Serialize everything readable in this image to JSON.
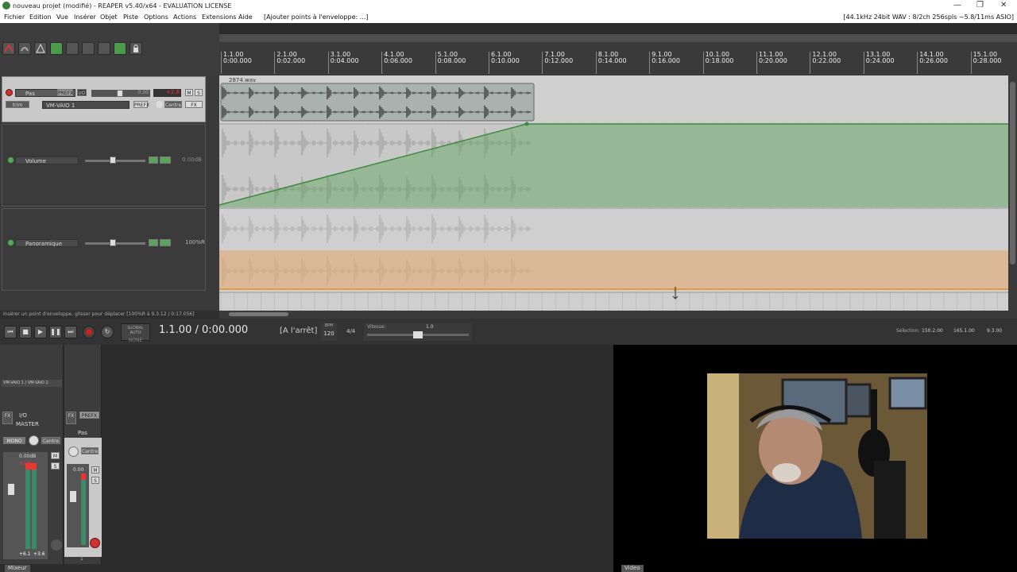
{
  "window": {
    "title": "nouveau projet (modifié) - REAPER v5.40/x64 - EVALUATION LICENSE",
    "controls": [
      "—",
      "❐",
      "✕"
    ]
  },
  "menu": {
    "items": [
      "Fichier",
      "Edition",
      "Vue",
      "Insérer",
      "Objet",
      "Piste",
      "Options",
      "Actions",
      "Extensions",
      "Aide",
      "[Ajouter points à l'enveloppe: ...]"
    ],
    "audio_info": "[44.1kHz 24bit WAV : 8/2ch 256spls ~5.8/11ms ASIO]"
  },
  "ruler": {
    "marks": [
      {
        "bar": "1.1.00",
        "time": "0:00.000"
      },
      {
        "bar": "2.1.00",
        "time": "0:02.000"
      },
      {
        "bar": "3.1.00",
        "time": "0:04.000"
      },
      {
        "bar": "4.1.00",
        "time": "0:06.000"
      },
      {
        "bar": "5.1.00",
        "time": "0:08.000"
      },
      {
        "bar": "6.1.00",
        "time": "0:10.000"
      },
      {
        "bar": "7.1.00",
        "time": "0:12.000"
      },
      {
        "bar": "8.1.00",
        "time": "0:14.000"
      },
      {
        "bar": "9.1.00",
        "time": "0:16.000"
      },
      {
        "bar": "10.1.00",
        "time": "0:18.000"
      },
      {
        "bar": "11.1.00",
        "time": "0:20.000"
      },
      {
        "bar": "12.1.00",
        "time": "0:22.000"
      },
      {
        "bar": "13.1.00",
        "time": "0:24.000"
      },
      {
        "bar": "14.1.00",
        "time": "0:26.000"
      },
      {
        "bar": "15.1.00",
        "time": "0:28.000"
      }
    ]
  },
  "track": {
    "name": "Pas",
    "fx_label": "FX",
    "io_label": "I/O",
    "volume": "0.00",
    "gain_readout": "+2.6",
    "mute": "M",
    "solo": "S",
    "input": "VM-VAIO 1",
    "trim_label": "trim",
    "pan_label": "Centre",
    "item_name": "2874.wav"
  },
  "envelopes": [
    {
      "name": "Volume",
      "value": "0.00dB",
      "color": "#5aa55a"
    },
    {
      "name": "Panoramique",
      "value": "100%R",
      "color": "#e0a060"
    }
  ],
  "status_text": "Insérer un point d'enveloppe, glisser pour déplacer [100%R à 9.3.12 / 0:17.056]",
  "transport": {
    "global_auto_label": "GLOBAL AUTO",
    "none_label": "NONE",
    "position": "1.1.00 / 0:00.000",
    "state": "[A l'arrêt]",
    "bpm_label": "BPM",
    "bpm": "120",
    "timesig": "4/4",
    "rate_label": "Vitesse:",
    "rate": "1.0",
    "selection_label": "Sélection:",
    "sel_start": "150.2.00",
    "sel_end": "165.1.00",
    "sel_len": "9.3.00"
  },
  "mixer": {
    "input_label": "VM-VAIO 1 / VM-VAIO 2",
    "master_label": "MASTER",
    "io_label": "I/O",
    "mono_label": "MONO",
    "pan_label": "Centre",
    "master_db": "0.00dB",
    "master_peak_l": "+6.1",
    "master_peak_r": "+3.6",
    "master_peak_top": "+2.8",
    "strip_name": "Pas",
    "strip_db": "0.00",
    "strip_index": "1",
    "fx_label": "FX",
    "prefx_label": "PREFX",
    "tab_label": "Mixeur"
  },
  "video": {
    "tab_label": "Video"
  }
}
